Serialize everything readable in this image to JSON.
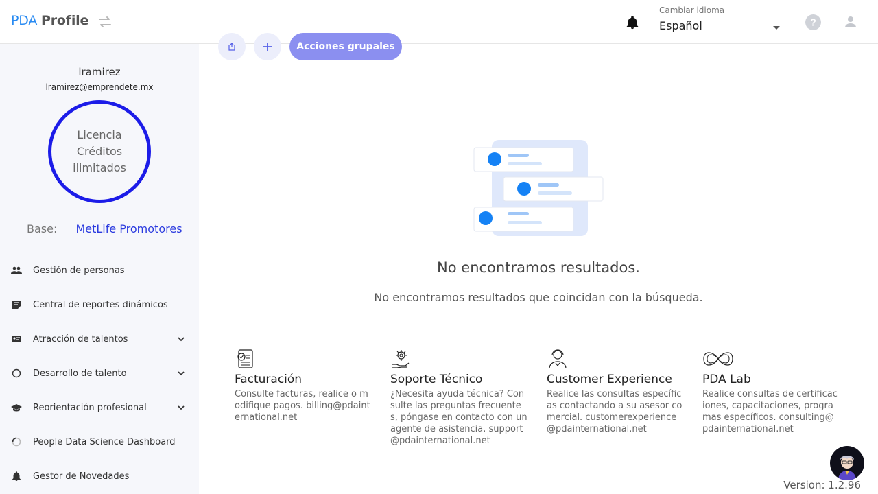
{
  "header": {
    "brand_a": "PDA",
    "brand_b": "Profile",
    "lang_label": "Cambiar idioma",
    "lang_value": "Español",
    "icons": [
      "swap-icon",
      "bell-icon",
      "chevron-down-icon",
      "help-icon",
      "user-icon"
    ]
  },
  "profile": {
    "username": "lramirez",
    "email": "lramirez@emprendete.mx",
    "license_lines": [
      "Licencia",
      "Créditos",
      "ilimitados"
    ],
    "base_label": "Base:",
    "base_value": "MetLife Promotores",
    "ring_color": "#1c1ce8"
  },
  "nav": [
    {
      "label": "Gestión de personas",
      "icon": "people-icon"
    },
    {
      "label": "Central de reportes dinámicos",
      "icon": "report-icon"
    },
    {
      "label": "Atracción de talentos",
      "icon": "id-card-icon",
      "expandable": true
    },
    {
      "label": "Desarrollo de talento",
      "icon": "circle-icon",
      "expandable": true
    },
    {
      "label": "Reorientación profesional",
      "icon": "graduation-cap-icon",
      "expandable": true
    },
    {
      "label": "People Data Science Dashboard",
      "icon": "loading-ring-icon"
    },
    {
      "label": "Gestor de Novedades",
      "icon": "bell-icon"
    }
  ],
  "toolbar": {
    "bulk_actions": "Acciones grupales",
    "accent": "#8b8ff0"
  },
  "empty": {
    "title": "No encontramos resultados.",
    "subtitle": "No encontramos resultados que coincidan con la búsqueda."
  },
  "cards": [
    {
      "title": "Facturación",
      "body": "Consulte facturas, realice o modifique pagos. billing@pdainternational.net",
      "icon": "invoice-icon"
    },
    {
      "title": "Soporte Técnico",
      "body": "¿Necesita ayuda técnica? Consulte las preguntas frecuentes, póngase en contacto con un agente de asistencia. support@pdainternational.net",
      "icon": "gear-hand-icon"
    },
    {
      "title": "Customer Experience",
      "body": "Realice las consultas específicas contactando a su asesor comercial. customerexperience@pdainternational.net",
      "icon": "headset-agent-icon"
    },
    {
      "title": "PDA Lab",
      "body": "Realice consultas de certificaciones, capacitaciones, programas específicos. consulting@pdainternational.net",
      "icon": "infinity-icon"
    }
  ],
  "footer": {
    "version": "Version: 1.2.96"
  }
}
